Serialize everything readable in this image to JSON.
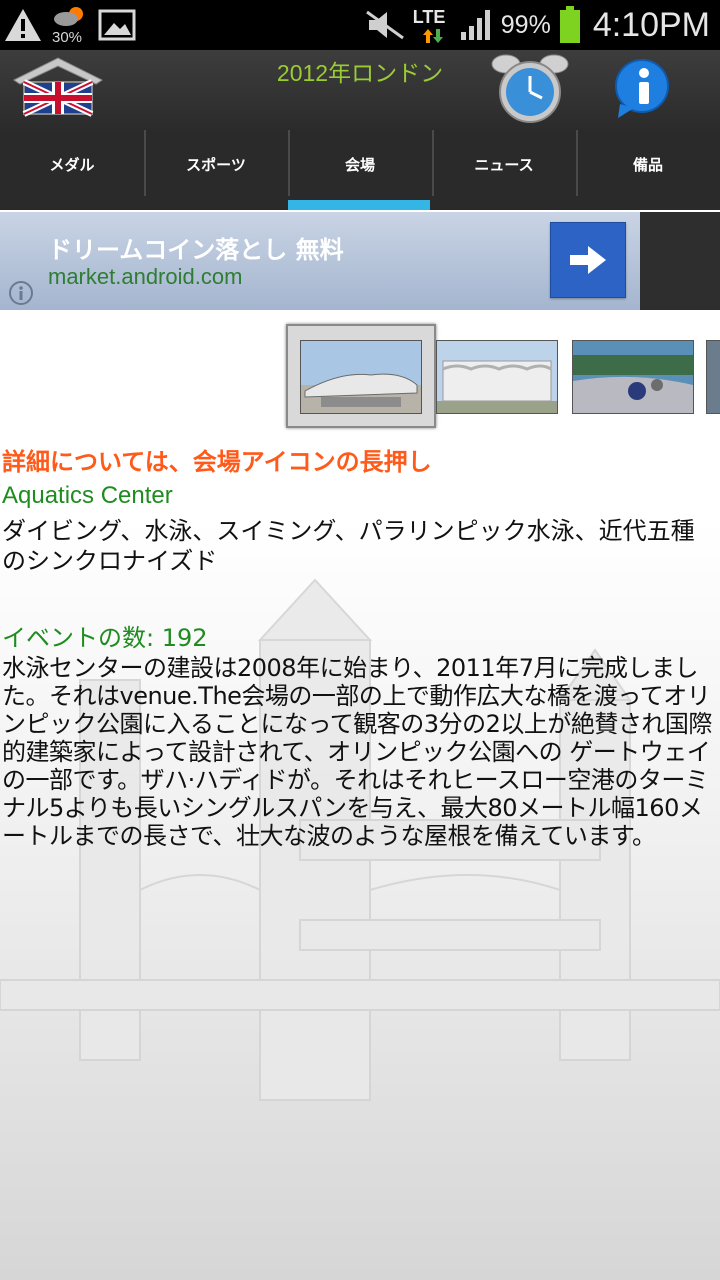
{
  "status_bar": {
    "weather_text": "30%",
    "battery_percent": "99%",
    "network_label": "LTE",
    "time": "4:10PM",
    "icons": [
      "warning-icon",
      "weather-icon",
      "gallery-icon",
      "mute-icon",
      "signal-icon",
      "battery-icon"
    ]
  },
  "action_bar": {
    "title": "2012年ロンドン",
    "title_color": "#9acd32",
    "icons": [
      "uk-home-icon",
      "alarm-clock-icon",
      "info-icon"
    ]
  },
  "tabs": [
    {
      "label": "メダル",
      "active": false
    },
    {
      "label": "スポーツ",
      "active": false
    },
    {
      "label": "会場",
      "active": true
    },
    {
      "label": "ニュース",
      "active": false
    },
    {
      "label": "備品",
      "active": false
    }
  ],
  "ad": {
    "title": "ドリームコイン落とし 無料",
    "url": "market.android.com",
    "icons": [
      "arrow-right-icon",
      "info-icon"
    ]
  },
  "content": {
    "hint": "詳細については、会場アイコンの長押し",
    "venue_name": "Aquatics Center",
    "sports": "ダイビング、水泳、スイミング、パラリンピック水泳、近代五種のシンクロナイズド",
    "events": "イベントの数: 192",
    "description": "水泳センターの建設は2008年に始まり、2011年7月に完成しました。それはvenue.The会場の一部の上で動作広大な橋を渡ってオリンピック公園に入ることになって観客の3分の2以上が絶賛され国際的建築家によって設計されて、オリンピック公園への ゲートウェイの一部です。ザハ·ハディドが。それはそれヒースロー空港のターミナル5よりも長いシングルスパンを与え、最大80メートル幅160メートルまでの長さで、壮大な波のような屋根を備えています。"
  },
  "colors": {
    "accent_tab": "#33b5e5",
    "hint": "#ff5a1a",
    "green_text": "#1e8c1e"
  }
}
